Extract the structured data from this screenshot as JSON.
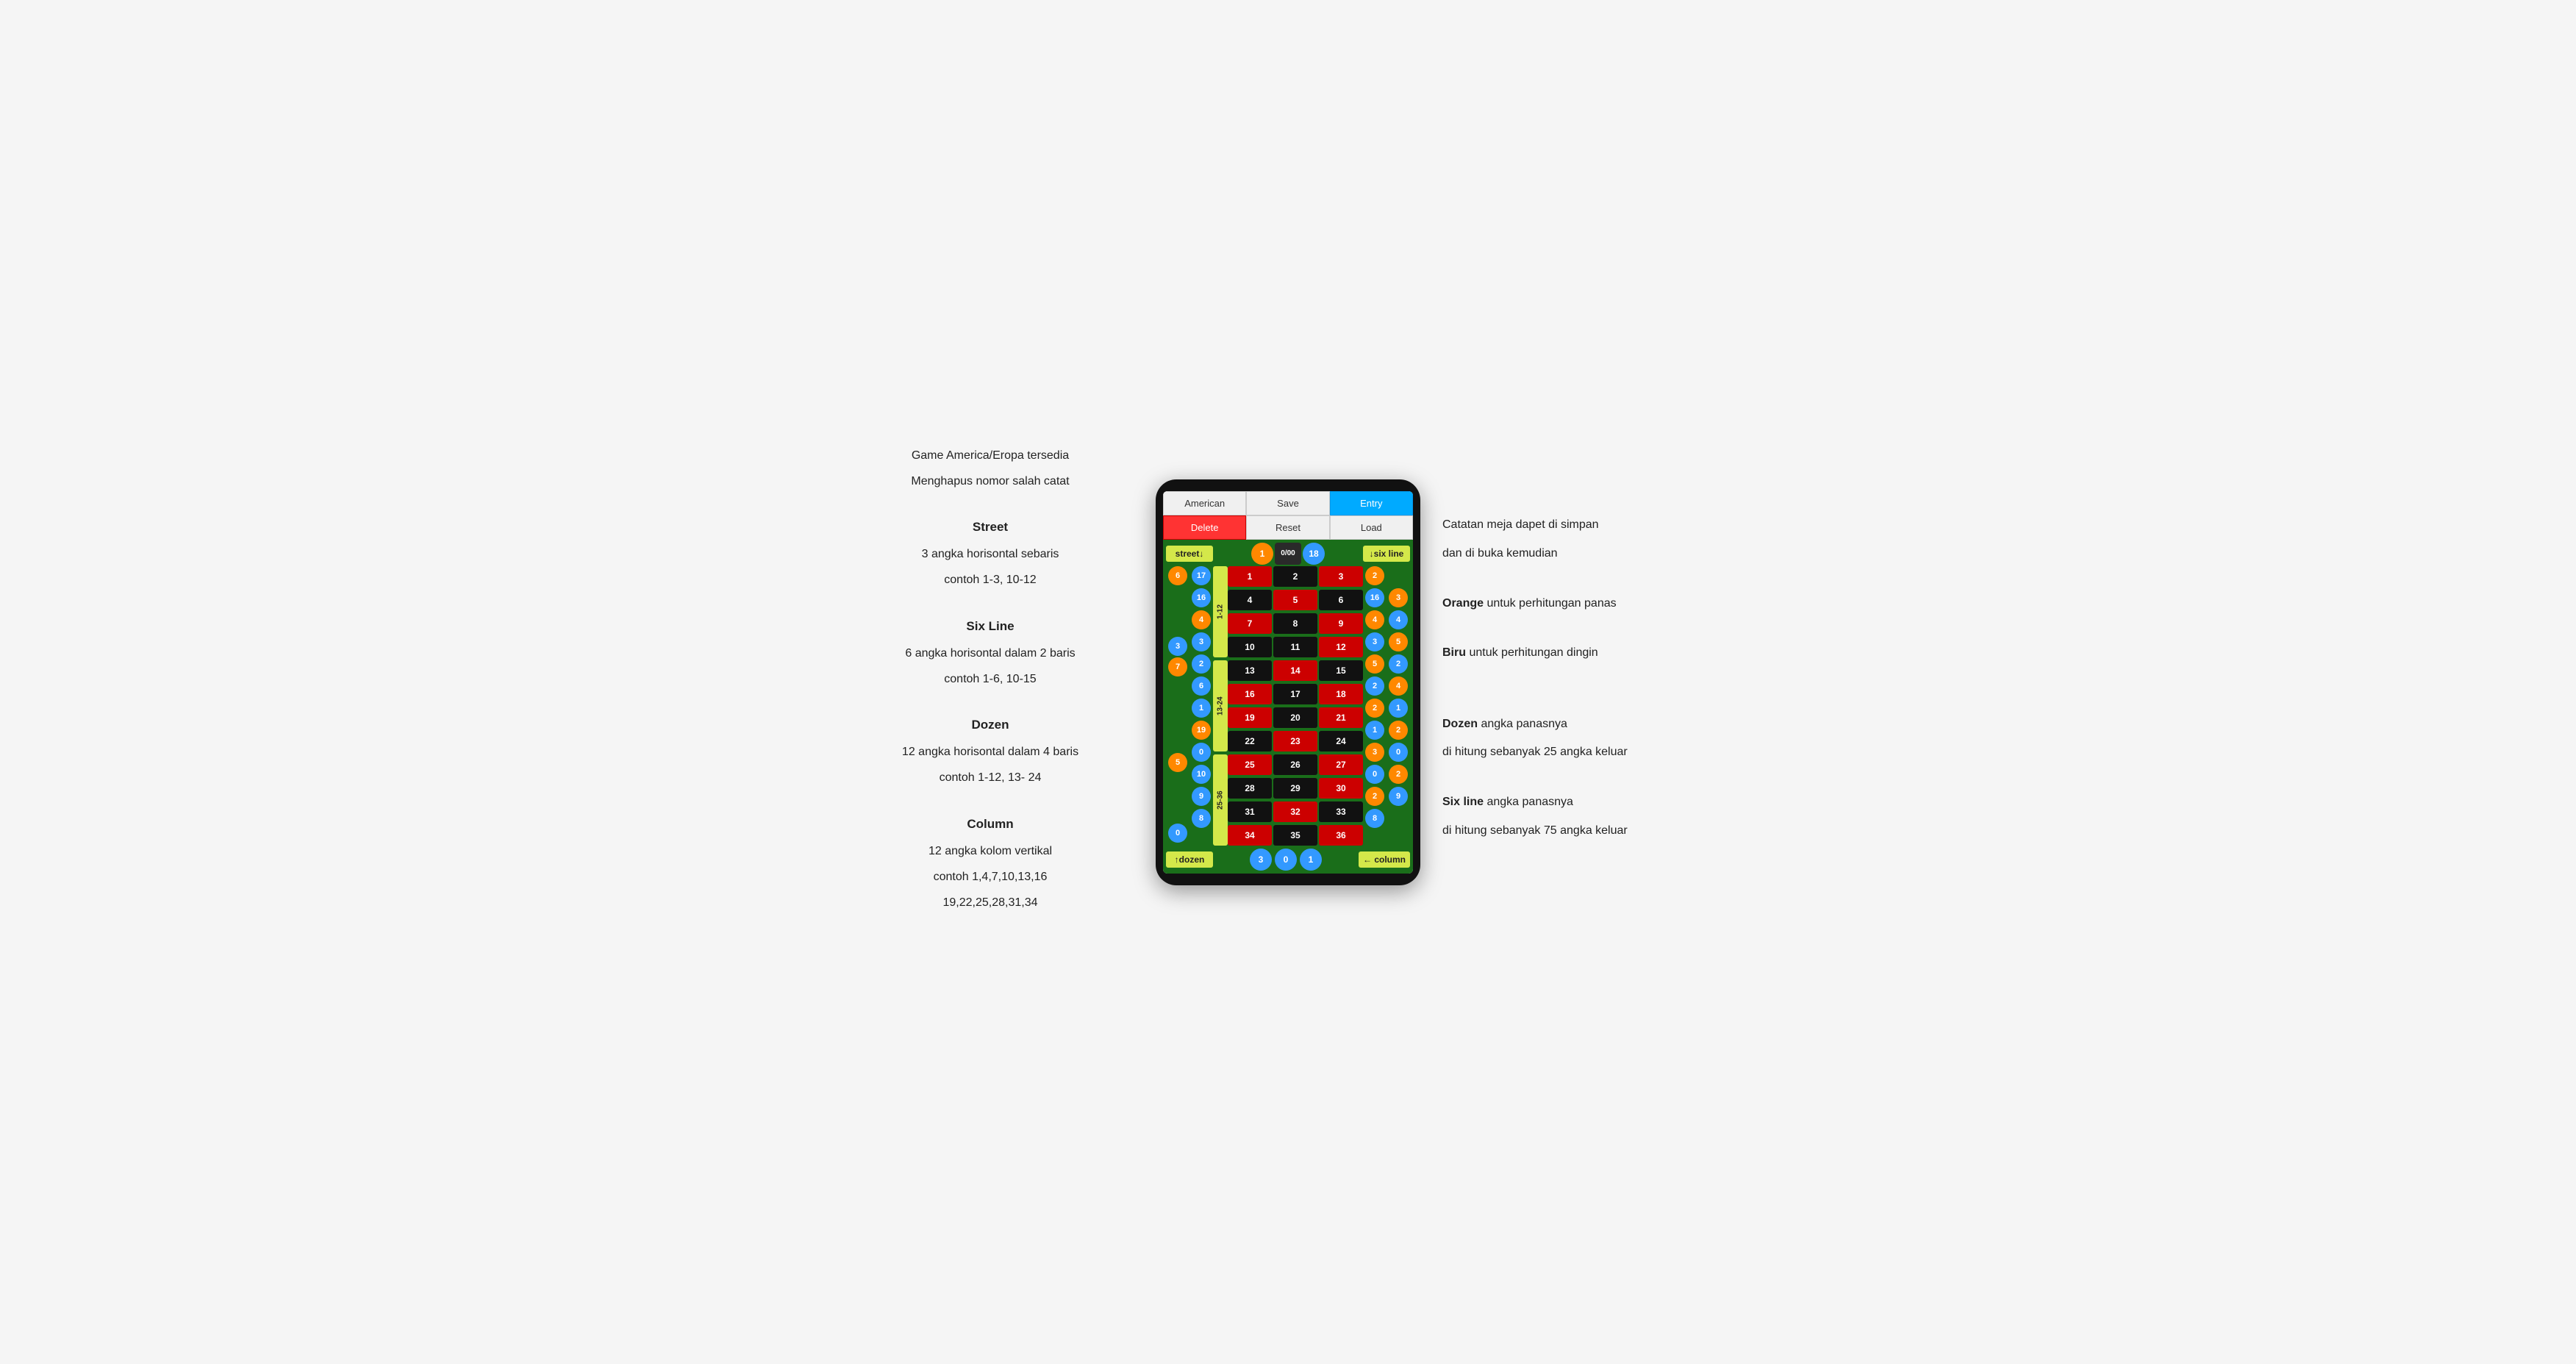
{
  "left_panel": {
    "line1": "Game America/Eropa tersedia",
    "line2": "Menghapus nomor salah catat",
    "street_title": "Street",
    "street_desc1": "3 angka horisontal sebaris",
    "street_desc2": "contoh 1-3, 10-12",
    "sixline_title": "Six Line",
    "sixline_desc1": "6 angka horisontal dalam 2 baris",
    "sixline_desc2": "contoh 1-6, 10-15",
    "dozen_title": "Dozen",
    "dozen_desc1": "12 angka horisontal dalam 4 baris",
    "dozen_desc2": "contoh 1-12, 13- 24",
    "column_title": "Column",
    "column_desc1": "12 angka kolom vertikal",
    "column_desc2": "contoh 1,4,7,10,13,16",
    "column_desc3": "19,22,25,28,31,34"
  },
  "right_panel": {
    "note1": "Catatan meja dapet di simpan",
    "note2": "dan di buka kemudian",
    "orange_title": "Orange",
    "orange_desc": "untuk perhitungan panas",
    "blue_title": "Biru",
    "blue_desc": "untuk perhitungan dingin",
    "dozen_title": "Dozen",
    "dozen_desc1": "angka panasnya",
    "dozen_desc2": "di hitung sebanyak 25 angka keluar",
    "sixline_title": "Six line",
    "sixline_desc1": "angka panasnya",
    "sixline_desc2": "di hitung sebanyak 75 angka keluar"
  },
  "buttons": {
    "american": "American",
    "save": "Save",
    "entry": "Entry",
    "delete": "Delete",
    "reset": "Reset",
    "load": "Load"
  },
  "header": {
    "street": "street↓",
    "sixline": "↓six line"
  },
  "zeros": [
    {
      "val": "1",
      "color": "orange"
    },
    {
      "val": "0/00",
      "color": "green"
    },
    {
      "val": "18",
      "color": "blue"
    }
  ],
  "footer": {
    "dozen": "↑dozen",
    "column": "← column",
    "circles": [
      {
        "val": "3",
        "color": "blue"
      },
      {
        "val": "0",
        "color": "blue"
      },
      {
        "val": "1",
        "color": "blue"
      }
    ]
  },
  "labels": {
    "l1": "1-12",
    "l2": "13-24",
    "l3": "25-36"
  },
  "rows": [
    {
      "left_circle": {
        "val": "6",
        "type": "orange"
      },
      "left_badge": {
        "val": "17",
        "type": "blue"
      },
      "nums": [
        {
          "n": "1",
          "c": "red"
        },
        {
          "n": "2",
          "c": "black"
        },
        {
          "n": "3",
          "c": "red"
        }
      ],
      "right_badge": {
        "val": "2",
        "type": "orange"
      },
      "right_circle": null
    },
    {
      "left_circle": null,
      "left_badge": {
        "val": "16",
        "type": "blue"
      },
      "nums": [
        {
          "n": "4",
          "c": "black"
        },
        {
          "n": "5",
          "c": "red"
        },
        {
          "n": "6",
          "c": "black"
        }
      ],
      "right_badge": {
        "val": "16",
        "type": "blue"
      },
      "right_circle": {
        "val": "3",
        "type": "orange"
      }
    },
    {
      "left_circle": null,
      "left_badge": {
        "val": "4",
        "type": "orange"
      },
      "nums": [
        {
          "n": "7",
          "c": "red"
        },
        {
          "n": "8",
          "c": "black"
        },
        {
          "n": "9",
          "c": "red"
        }
      ],
      "right_badge": {
        "val": "4",
        "type": "orange"
      },
      "right_circle": {
        "val": "4",
        "type": "blue"
      }
    },
    {
      "left_circle": {
        "val": "3",
        "type": "blue"
      },
      "left_badge": {
        "val": "3",
        "type": "blue"
      },
      "nums": [
        {
          "n": "10",
          "c": "black"
        },
        {
          "n": "11",
          "c": "black"
        },
        {
          "n": "12",
          "c": "red"
        }
      ],
      "right_badge": {
        "val": "3",
        "type": "blue"
      },
      "right_circle": {
        "val": "5",
        "type": "orange"
      }
    },
    {
      "left_circle": {
        "val": "7",
        "type": "orange"
      },
      "left_badge": {
        "val": "2",
        "type": "blue"
      },
      "nums": [
        {
          "n": "13",
          "c": "black"
        },
        {
          "n": "14",
          "c": "red"
        },
        {
          "n": "15",
          "c": "black"
        }
      ],
      "right_badge": {
        "val": "5",
        "type": "orange"
      },
      "right_circle": {
        "val": "2",
        "type": "blue"
      }
    },
    {
      "left_circle": null,
      "left_badge": {
        "val": "6",
        "type": "blue"
      },
      "nums": [
        {
          "n": "16",
          "c": "red"
        },
        {
          "n": "17",
          "c": "black"
        },
        {
          "n": "18",
          "c": "red"
        }
      ],
      "right_badge": {
        "val": "2",
        "type": "blue"
      },
      "right_circle": {
        "val": "4",
        "type": "orange"
      }
    },
    {
      "left_circle": null,
      "left_badge": {
        "val": "1",
        "type": "blue"
      },
      "nums": [
        {
          "n": "19",
          "c": "red"
        },
        {
          "n": "20",
          "c": "black"
        },
        {
          "n": "21",
          "c": "red"
        }
      ],
      "right_badge": {
        "val": "2",
        "type": "orange"
      },
      "right_circle": {
        "val": "1",
        "type": "blue"
      }
    },
    {
      "left_circle": null,
      "left_badge": {
        "val": "19",
        "type": "orange"
      },
      "nums": [
        {
          "n": "22",
          "c": "black"
        },
        {
          "n": "23",
          "c": "red"
        },
        {
          "n": "24",
          "c": "black"
        }
      ],
      "right_badge": {
        "val": "1",
        "type": "blue"
      },
      "right_circle": {
        "val": "2",
        "type": "orange"
      }
    },
    {
      "left_circle": {
        "val": "5",
        "type": "orange"
      },
      "left_badge": {
        "val": "0",
        "type": "blue"
      },
      "nums": [
        {
          "n": "25",
          "c": "red"
        },
        {
          "n": "26",
          "c": "black"
        },
        {
          "n": "27",
          "c": "red"
        }
      ],
      "right_badge": {
        "val": "3",
        "type": "orange"
      },
      "right_circle": {
        "val": "0",
        "type": "blue"
      }
    },
    {
      "left_circle": null,
      "left_badge": {
        "val": "10",
        "type": "blue"
      },
      "nums": [
        {
          "n": "28",
          "c": "black"
        },
        {
          "n": "29",
          "c": "black"
        },
        {
          "n": "30",
          "c": "red"
        }
      ],
      "right_badge": {
        "val": "0",
        "type": "blue"
      },
      "right_circle": {
        "val": "2",
        "type": "orange"
      }
    },
    {
      "left_circle": null,
      "left_badge": {
        "val": "9",
        "type": "blue"
      },
      "nums": [
        {
          "n": "31",
          "c": "black"
        },
        {
          "n": "32",
          "c": "red"
        },
        {
          "n": "33",
          "c": "black"
        }
      ],
      "right_badge": {
        "val": "2",
        "type": "orange"
      },
      "right_circle": {
        "val": "9",
        "type": "blue"
      }
    },
    {
      "left_circle": {
        "val": "0",
        "type": "blue"
      },
      "left_badge": {
        "val": "8",
        "type": "blue"
      },
      "nums": [
        {
          "n": "34",
          "c": "red"
        },
        {
          "n": "35",
          "c": "black"
        },
        {
          "n": "36",
          "c": "red"
        }
      ],
      "right_badge": {
        "val": "8",
        "type": "blue"
      },
      "right_circle": null
    }
  ]
}
